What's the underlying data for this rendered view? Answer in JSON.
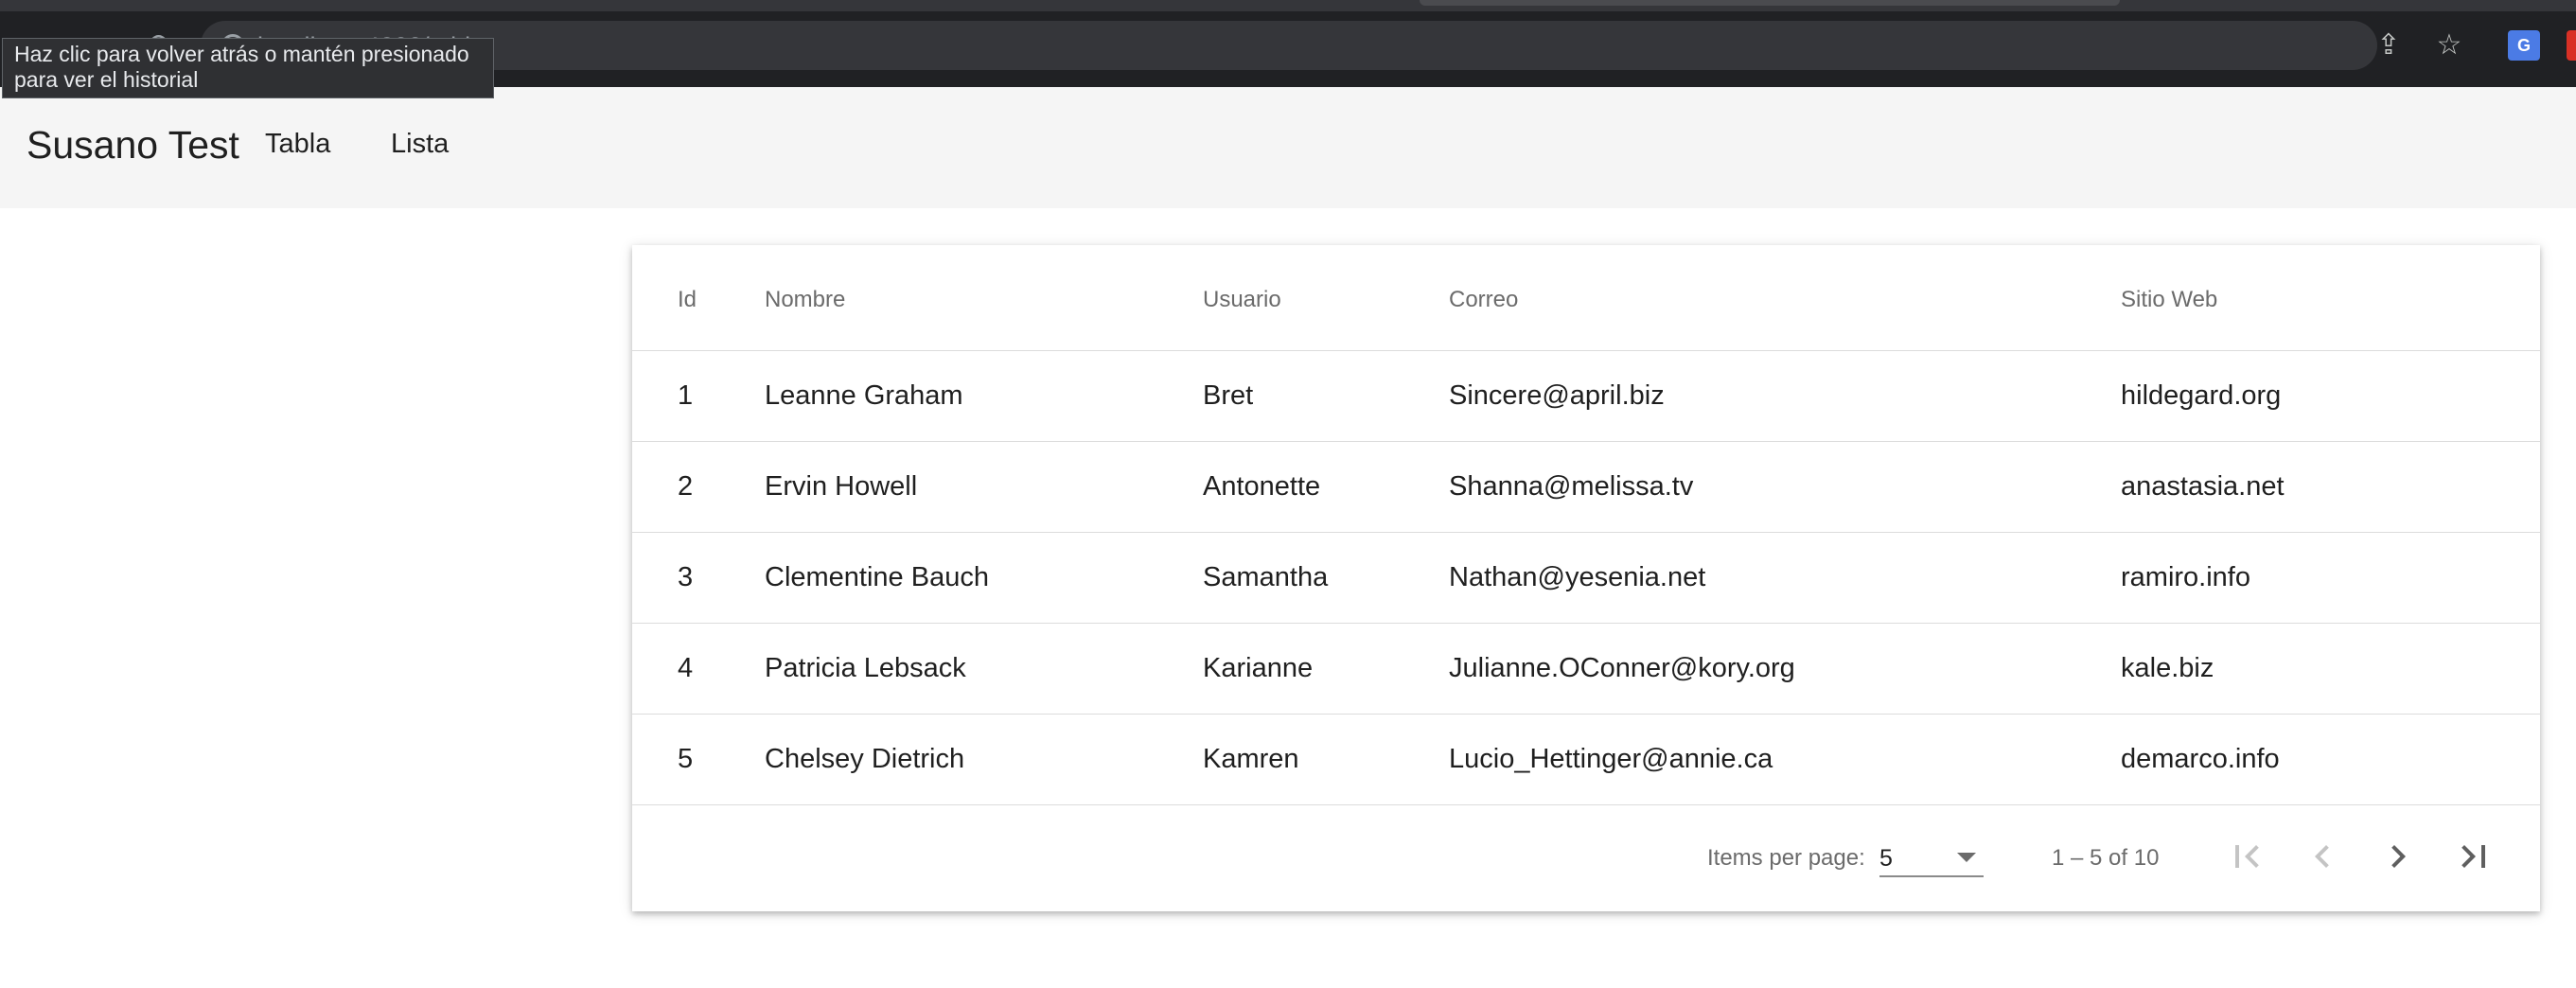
{
  "browser": {
    "url_text": "localhost:4200/tabla",
    "tooltip": {
      "line1": "Haz clic para volver atrás o mantén presionado",
      "line2": "para ver el historial"
    },
    "icons": [
      "back-icon",
      "forward-icon",
      "reload-icon",
      "info-icon",
      "share-icon",
      "star-icon",
      "translate-icon",
      "extension-icon"
    ],
    "colors": {
      "frame": "#202124",
      "omnibox": "#35363a"
    }
  },
  "app": {
    "title": "Susano Test",
    "nav": [
      {
        "label": "Tabla"
      },
      {
        "label": "Lista"
      }
    ],
    "header_bg": "#f5f5f5"
  },
  "table": {
    "columns": [
      "Id",
      "Nombre",
      "Usuario",
      "Correo",
      "Sitio Web"
    ],
    "rows": [
      [
        "1",
        "Leanne Graham",
        "Bret",
        "Sincere@april.biz",
        "hildegard.org"
      ],
      [
        "2",
        "Ervin Howell",
        "Antonette",
        "Shanna@melissa.tv",
        "anastasia.net"
      ],
      [
        "3",
        "Clementine Bauch",
        "Samantha",
        "Nathan@yesenia.net",
        "ramiro.info"
      ],
      [
        "4",
        "Patricia Lebsack",
        "Karianne",
        "Julianne.OConner@kory.org",
        "kale.biz"
      ],
      [
        "5",
        "Chelsey Dietrich",
        "Kamren",
        "Lucio_Hettinger@annie.ca",
        "demarco.info"
      ]
    ]
  },
  "paginator": {
    "items_per_page_label": "Items per page:",
    "items_per_page_value": "5",
    "range_label": "1 – 5 of 10",
    "buttons": [
      "first-page-icon",
      "previous-page-icon",
      "next-page-icon",
      "last-page-icon"
    ]
  }
}
